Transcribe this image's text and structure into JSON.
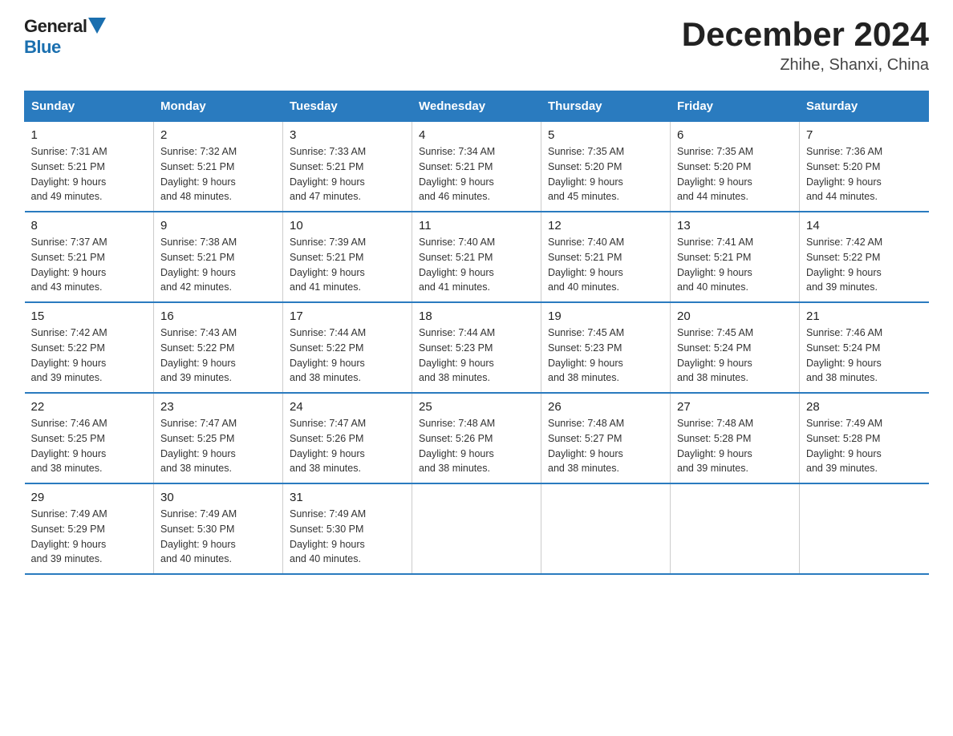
{
  "logo": {
    "general": "General",
    "blue": "Blue"
  },
  "title": "December 2024",
  "subtitle": "Zhihe, Shanxi, China",
  "headers": [
    "Sunday",
    "Monday",
    "Tuesday",
    "Wednesday",
    "Thursday",
    "Friday",
    "Saturday"
  ],
  "weeks": [
    [
      {
        "day": "1",
        "sunrise": "7:31 AM",
        "sunset": "5:21 PM",
        "daylight": "9 hours and 49 minutes."
      },
      {
        "day": "2",
        "sunrise": "7:32 AM",
        "sunset": "5:21 PM",
        "daylight": "9 hours and 48 minutes."
      },
      {
        "day": "3",
        "sunrise": "7:33 AM",
        "sunset": "5:21 PM",
        "daylight": "9 hours and 47 minutes."
      },
      {
        "day": "4",
        "sunrise": "7:34 AM",
        "sunset": "5:21 PM",
        "daylight": "9 hours and 46 minutes."
      },
      {
        "day": "5",
        "sunrise": "7:35 AM",
        "sunset": "5:20 PM",
        "daylight": "9 hours and 45 minutes."
      },
      {
        "day": "6",
        "sunrise": "7:35 AM",
        "sunset": "5:20 PM",
        "daylight": "9 hours and 44 minutes."
      },
      {
        "day": "7",
        "sunrise": "7:36 AM",
        "sunset": "5:20 PM",
        "daylight": "9 hours and 44 minutes."
      }
    ],
    [
      {
        "day": "8",
        "sunrise": "7:37 AM",
        "sunset": "5:21 PM",
        "daylight": "9 hours and 43 minutes."
      },
      {
        "day": "9",
        "sunrise": "7:38 AM",
        "sunset": "5:21 PM",
        "daylight": "9 hours and 42 minutes."
      },
      {
        "day": "10",
        "sunrise": "7:39 AM",
        "sunset": "5:21 PM",
        "daylight": "9 hours and 41 minutes."
      },
      {
        "day": "11",
        "sunrise": "7:40 AM",
        "sunset": "5:21 PM",
        "daylight": "9 hours and 41 minutes."
      },
      {
        "day": "12",
        "sunrise": "7:40 AM",
        "sunset": "5:21 PM",
        "daylight": "9 hours and 40 minutes."
      },
      {
        "day": "13",
        "sunrise": "7:41 AM",
        "sunset": "5:21 PM",
        "daylight": "9 hours and 40 minutes."
      },
      {
        "day": "14",
        "sunrise": "7:42 AM",
        "sunset": "5:22 PM",
        "daylight": "9 hours and 39 minutes."
      }
    ],
    [
      {
        "day": "15",
        "sunrise": "7:42 AM",
        "sunset": "5:22 PM",
        "daylight": "9 hours and 39 minutes."
      },
      {
        "day": "16",
        "sunrise": "7:43 AM",
        "sunset": "5:22 PM",
        "daylight": "9 hours and 39 minutes."
      },
      {
        "day": "17",
        "sunrise": "7:44 AM",
        "sunset": "5:22 PM",
        "daylight": "9 hours and 38 minutes."
      },
      {
        "day": "18",
        "sunrise": "7:44 AM",
        "sunset": "5:23 PM",
        "daylight": "9 hours and 38 minutes."
      },
      {
        "day": "19",
        "sunrise": "7:45 AM",
        "sunset": "5:23 PM",
        "daylight": "9 hours and 38 minutes."
      },
      {
        "day": "20",
        "sunrise": "7:45 AM",
        "sunset": "5:24 PM",
        "daylight": "9 hours and 38 minutes."
      },
      {
        "day": "21",
        "sunrise": "7:46 AM",
        "sunset": "5:24 PM",
        "daylight": "9 hours and 38 minutes."
      }
    ],
    [
      {
        "day": "22",
        "sunrise": "7:46 AM",
        "sunset": "5:25 PM",
        "daylight": "9 hours and 38 minutes."
      },
      {
        "day": "23",
        "sunrise": "7:47 AM",
        "sunset": "5:25 PM",
        "daylight": "9 hours and 38 minutes."
      },
      {
        "day": "24",
        "sunrise": "7:47 AM",
        "sunset": "5:26 PM",
        "daylight": "9 hours and 38 minutes."
      },
      {
        "day": "25",
        "sunrise": "7:48 AM",
        "sunset": "5:26 PM",
        "daylight": "9 hours and 38 minutes."
      },
      {
        "day": "26",
        "sunrise": "7:48 AM",
        "sunset": "5:27 PM",
        "daylight": "9 hours and 38 minutes."
      },
      {
        "day": "27",
        "sunrise": "7:48 AM",
        "sunset": "5:28 PM",
        "daylight": "9 hours and 39 minutes."
      },
      {
        "day": "28",
        "sunrise": "7:49 AM",
        "sunset": "5:28 PM",
        "daylight": "9 hours and 39 minutes."
      }
    ],
    [
      {
        "day": "29",
        "sunrise": "7:49 AM",
        "sunset": "5:29 PM",
        "daylight": "9 hours and 39 minutes."
      },
      {
        "day": "30",
        "sunrise": "7:49 AM",
        "sunset": "5:30 PM",
        "daylight": "9 hours and 40 minutes."
      },
      {
        "day": "31",
        "sunrise": "7:49 AM",
        "sunset": "5:30 PM",
        "daylight": "9 hours and 40 minutes."
      },
      null,
      null,
      null,
      null
    ]
  ]
}
